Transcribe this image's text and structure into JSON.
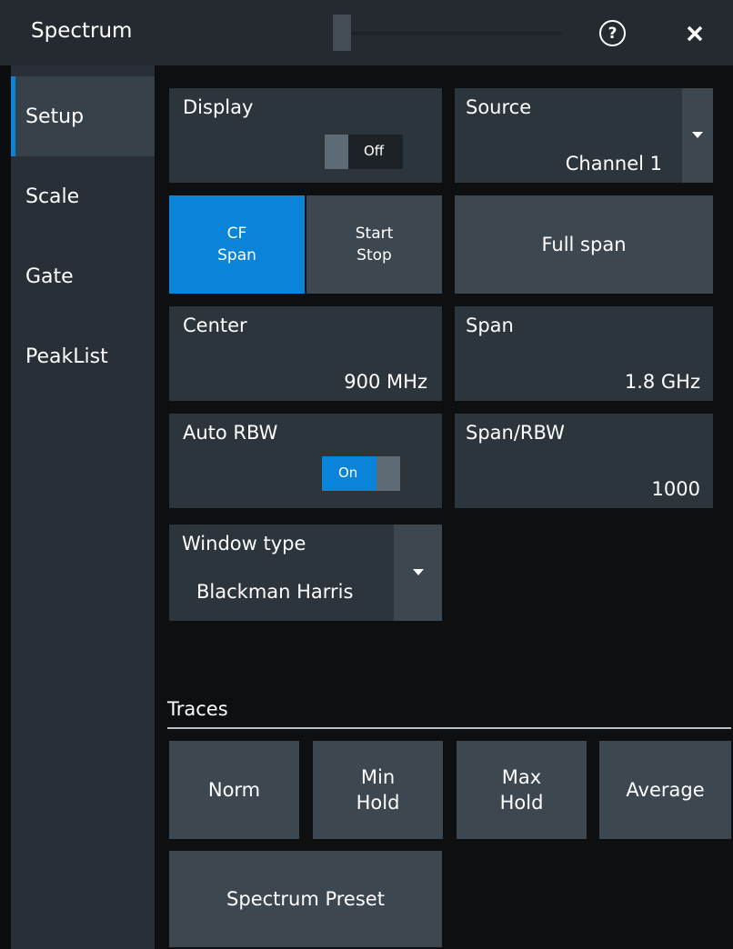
{
  "window": {
    "title": "Spectrum",
    "help_icon_glyph": "?",
    "close_icon_glyph": "✕"
  },
  "sidebar": {
    "items": [
      {
        "label": "Setup",
        "active": true
      },
      {
        "label": "Scale",
        "active": false
      },
      {
        "label": "Gate",
        "active": false
      },
      {
        "label": "PeakList",
        "active": false
      }
    ]
  },
  "setup": {
    "display": {
      "label": "Display",
      "state": "Off"
    },
    "source": {
      "label": "Source",
      "value": "Channel 1"
    },
    "mode": {
      "cf_span": "CF\nSpan",
      "start_stop": "Start\nStop",
      "selected": "CF Span"
    },
    "full_span": "Full span",
    "center": {
      "label": "Center",
      "value": "900 MHz"
    },
    "span": {
      "label": "Span",
      "value": "1.8 GHz"
    },
    "auto_rbw": {
      "label": "Auto RBW",
      "state": "On"
    },
    "span_rbw": {
      "label": "Span/RBW",
      "value": "1000"
    },
    "window_type": {
      "label": "Window type",
      "value": "Blackman Harris"
    }
  },
  "traces": {
    "title": "Traces",
    "buttons": [
      "Norm",
      "Min\nHold",
      "Max\nHold",
      "Average"
    ],
    "preset": "Spectrum Preset"
  },
  "colors": {
    "accent": "#0a84d8",
    "tile": "#2d353c",
    "button": "#3d4750"
  }
}
